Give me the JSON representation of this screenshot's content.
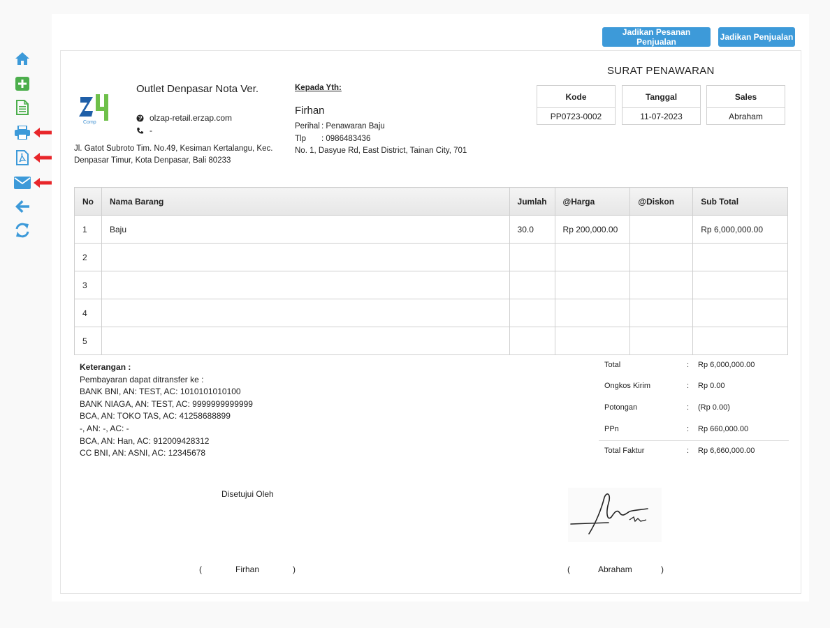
{
  "sidebar": {
    "items": [
      {
        "icon": "home-icon",
        "color": "#3d9ad9"
      },
      {
        "icon": "plus-square-icon",
        "color": "#4cae4c"
      },
      {
        "icon": "document-icon",
        "color": "#4cae4c"
      },
      {
        "icon": "print-icon",
        "color": "#3d9ad9"
      },
      {
        "icon": "pdf-icon",
        "color": "#3d9ad9"
      },
      {
        "icon": "email-icon",
        "color": "#3d9ad9"
      },
      {
        "icon": "back-arrow-icon",
        "color": "#3d9ad9"
      },
      {
        "icon": "refresh-icon",
        "color": "#3d9ad9"
      }
    ],
    "annotation_arrow_color": "#e8262a"
  },
  "toolbar": {
    "btn_sales_order": "Jadikan Pesanan Penjualan",
    "btn_sale": "Jadikan Penjualan"
  },
  "outlet": {
    "name": "Outlet Denpasar Nota Ver.",
    "website": "olzap-retail.erzap.com",
    "phone": "-",
    "address": "Jl. Gatot Subroto Tim. No.49, Kesiman Kertalangu, Kec. Denpasar Timur, Kota Denpasar, Bali 80233",
    "logo_text": "Comp"
  },
  "customer": {
    "to_label": "Kepada Yth:",
    "name": "Firhan",
    "subject_label": "Perihal",
    "subject": ": Penawaran Baju",
    "phone_label": "Tlp",
    "phone": ": 0986483436",
    "address": "No. 1, Dasyue Rd, East District, Tainan City, 701"
  },
  "document": {
    "title": "SURAT PENAWARAN",
    "code_label": "Kode",
    "code": "PP0723-0002",
    "date_label": "Tanggal",
    "date": "11-07-2023",
    "sales_label": "Sales",
    "sales": "Abraham"
  },
  "table": {
    "headers": [
      "No",
      "Nama Barang",
      "Jumlah",
      "@Harga",
      "@Diskon",
      "Sub Total"
    ],
    "rows": [
      [
        "1",
        "Baju",
        "30.0",
        "Rp 200,000.00",
        "",
        "Rp 6,000,000.00"
      ],
      [
        "2",
        "",
        "",
        "",
        "",
        ""
      ],
      [
        "3",
        "",
        "",
        "",
        "",
        ""
      ],
      [
        "4",
        "",
        "",
        "",
        "",
        ""
      ],
      [
        "5",
        "",
        "",
        "",
        "",
        ""
      ]
    ]
  },
  "notes": {
    "title": "Keterangan :",
    "lines": [
      "Pembayaran dapat ditransfer ke :",
      "BANK BNI, AN: TEST, AC: 1010101010100",
      "BANK NIAGA, AN: TEST, AC: 9999999999999",
      "BCA, AN: TOKO TAS, AC: 41258688899",
      "-, AN: -, AC: -",
      "BCA, AN: Han, AC: 912009428312",
      "CC BNI, AN: ASNI, AC: 12345678"
    ]
  },
  "totals": {
    "rows": [
      {
        "label": "Total",
        "colon": ":",
        "value": "Rp 6,000,000.00"
      },
      {
        "label": "Ongkos Kirim",
        "colon": ":",
        "value": "Rp 0.00"
      },
      {
        "label": "Potongan",
        "colon": ":",
        "value": "(Rp 0.00)"
      },
      {
        "label": "PPn",
        "colon": ":",
        "value": "Rp 660,000.00"
      },
      {
        "label": "Total Faktur",
        "colon": ":",
        "value": "Rp 6,660,000.00"
      }
    ]
  },
  "signatures": {
    "approved_label": "Disetujui Oleh",
    "left_open": "(",
    "left_name": "Firhan",
    "left_close": ")",
    "right_open": "(",
    "right_name": "Abraham",
    "right_close": ")"
  }
}
